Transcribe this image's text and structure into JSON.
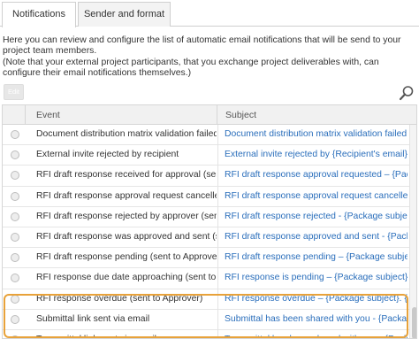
{
  "tabs": [
    {
      "label": "Notifications",
      "active": true
    },
    {
      "label": "Sender and format",
      "active": false
    }
  ],
  "intro": {
    "line1": "Here you can review and configure the list of automatic email notifications that will be send to your project team members.",
    "line2": "(Note that your external project participants, that you exchange project deliverables with, can configure their email notifications themselves.)"
  },
  "toolbar": {
    "edit_label": "Edit",
    "search_icon": "search-icon"
  },
  "table": {
    "headers": {
      "event": "Event",
      "subject": "Subject"
    },
    "rows": [
      {
        "event": "Document distribution matrix validation failed",
        "subject": "Document distribution matrix validation failed - {..."
      },
      {
        "event": "External invite rejected by recipient",
        "subject": "External invite rejected by {Recipient's email}"
      },
      {
        "event": "RFI draft response received for approval (sent to approver)",
        "subject": "RFI draft response approval requested – {Package..."
      },
      {
        "event": "RFI draft response approval request cancelled (sent to approver)",
        "subject": "RFI draft response approval request cancelled - {..."
      },
      {
        "event": "RFI draft response rejected by approver (sent to responder)",
        "subject": "RFI draft response rejected - {Package subject}. {Pa..."
      },
      {
        "event": "RFI draft response was approved and sent (sent to responder)",
        "subject": "RFI draft response approved and sent - {Package..."
      },
      {
        "event": "RFI draft response pending (sent to Approver)",
        "subject": "RFI draft response pending – {Package subject}. {..."
      },
      {
        "event": "RFI response due date approaching (sent to Approver)",
        "subject": "RFI response is pending – {Package subject}. {Pac..."
      },
      {
        "event": "RFI response overdue (sent to Approver)",
        "subject": "RFI response overdue – {Package subject}. {Packa..."
      },
      {
        "event": "Submittal link sent via email",
        "subject": "Submittal has been shared with you - {Package s..."
      },
      {
        "event": "Transmittal link sent via email",
        "subject": "Transmittal has been shared with you - {Package s..."
      }
    ]
  },
  "colors": {
    "link": "#2a6ebb",
    "highlight": "#e8a23a"
  }
}
